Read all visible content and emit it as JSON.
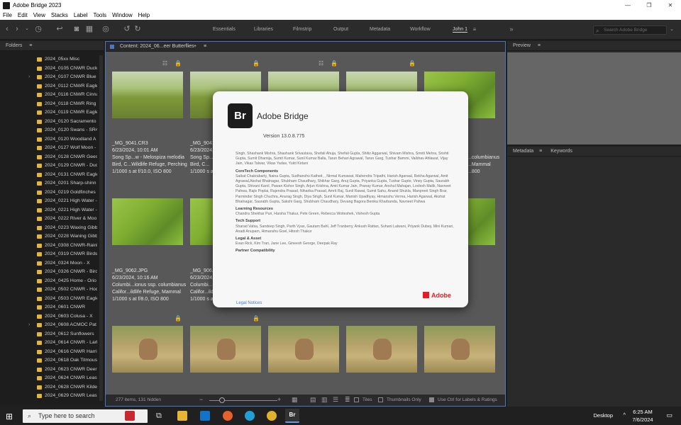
{
  "window": {
    "title": "Adobe Bridge 2023",
    "controls": [
      "—",
      "❐",
      "✕"
    ]
  },
  "menu": [
    "File",
    "Edit",
    "View",
    "Stacks",
    "Label",
    "Tools",
    "Window",
    "Help"
  ],
  "workspaces": [
    "Essentials",
    "Libraries",
    "Filmstrip",
    "Output",
    "Metadata",
    "Workflow",
    "John 1"
  ],
  "search_placeholder": "Search Adobe Bridge",
  "folders_panel": {
    "title": "Folders",
    "items": [
      {
        "name": "2024_05xx Misc",
        "expand": ""
      },
      {
        "name": "2024_0105 CNWR Ducks",
        "expand": ""
      },
      {
        "name": "2024_0107 CNWR Blue W",
        "expand": "›"
      },
      {
        "name": "2024_0112 CNWR Eagle",
        "expand": ""
      },
      {
        "name": "2024_0116 CNWR Cinna",
        "expand": ""
      },
      {
        "name": "2024_0118 CNWR Ring N",
        "expand": ""
      },
      {
        "name": "2024_0119 CNWR Eagle",
        "expand": ""
      },
      {
        "name": "2024_0120 Sacramento",
        "expand": ""
      },
      {
        "name": "2024_0120 Swans - SR45",
        "expand": ""
      },
      {
        "name": "2024_0120 Woodland A",
        "expand": ""
      },
      {
        "name": "2024_0127 Wolf Moon -",
        "expand": ""
      },
      {
        "name": "2024_0128 CNWR Geese",
        "expand": ""
      },
      {
        "name": "2024_0129 CNWR - Duc",
        "expand": ""
      },
      {
        "name": "2024_0131 CNWR Eagle",
        "expand": ""
      },
      {
        "name": "2024_0201 Sharp-shinn",
        "expand": ""
      },
      {
        "name": "2024_0219 Goldfinches",
        "expand": ""
      },
      {
        "name": "2024_0221 High Water -",
        "expand": ""
      },
      {
        "name": "2024_0221 High Water -",
        "expand": ""
      },
      {
        "name": "2024_0222 River & Moo",
        "expand": ""
      },
      {
        "name": "2024_0223 Waxing Gibb",
        "expand": ""
      },
      {
        "name": "2024_0228 Waning Gibb",
        "expand": ""
      },
      {
        "name": "2024_0308 CNWR-Rainb",
        "expand": ""
      },
      {
        "name": "2024_0319 CNWR Birds",
        "expand": ""
      },
      {
        "name": "2024_0324 Moon - X",
        "expand": ""
      },
      {
        "name": "2024_0326 CNWR - Bird",
        "expand": ""
      },
      {
        "name": "2024_0425 Home - Orio",
        "expand": ""
      },
      {
        "name": "2024_0502 CNWR - Hoc",
        "expand": ""
      },
      {
        "name": "2024_0503 CNWR Eagle",
        "expand": ""
      },
      {
        "name": "2024_0601 CNWR",
        "expand": ""
      },
      {
        "name": "2024_0603 Colusa - X",
        "expand": ""
      },
      {
        "name": "2024_0608 ACMOC Pat",
        "expand": "›"
      },
      {
        "name": "2024_0612 Sunflowers",
        "expand": ""
      },
      {
        "name": "2024_0614 CNWR - Lark",
        "expand": ""
      },
      {
        "name": "2024_0616 CNWR Harri",
        "expand": ""
      },
      {
        "name": "2024_0618 Oak Titmous",
        "expand": ""
      },
      {
        "name": "2024_0623 CNWR Deer",
        "expand": ""
      },
      {
        "name": "2024_0624 CNWR Least",
        "expand": ""
      },
      {
        "name": "2024_0628 CNWR Kildee",
        "expand": ""
      },
      {
        "name": "2024_0629 CNWR Least",
        "expand": ""
      }
    ]
  },
  "content_panel": {
    "title": "Content: 2024_06...eer Butterflies",
    "add_icon": "+",
    "items": [
      {
        "filename": "_MG_9041.CR3",
        "date": "6/23/2024, 10:01 AM",
        "desc1": "Song Sp...w - Melospiza melodia",
        "desc2": "Bird, C...Wildlife Refuge, Perching",
        "exposure": "1/1000 s at f/10.0, ISO 800"
      },
      {
        "filename": "_MG_9041...",
        "date": "6/23/2024,...",
        "desc1": "Song Sp...",
        "desc2": "Bird, C...",
        "exposure": "1/1000 s a..."
      },
      {
        "filename": "_MG_9062.JPG",
        "date": "6/23/2024, 10:16 AM",
        "desc1": "Columbi...ionus ssp. columbianus",
        "desc2": "Califor...ildlife Refuge, Mammal",
        "exposure": "1/1000 s at f/8.0, ISO 800"
      },
      {
        "filename": "_MG_906...",
        "date": "6/23/2024,...",
        "desc1": "Columbi...io",
        "desc2": "Califor...ild",
        "exposure": "1/1000 s a..."
      },
      {
        "filename": "",
        "date": "",
        "desc1": "...columbianus",
        "desc2": "...Mammal",
        "exposure": "...800"
      }
    ],
    "footer": {
      "count": "277 items, 131 hidden",
      "tiles_label": "Tiles",
      "thumbs_only": "Thumbnails Only",
      "ctrl_label": "Use Ctrl for Labels & Ratings"
    }
  },
  "preview_panel": {
    "title": "Preview"
  },
  "metadata_panel": {
    "tab1": "Metadata",
    "tab2": "Keywords"
  },
  "about_dialog": {
    "logo": "Br",
    "name": "Adobe Bridge",
    "version": "Version 13.0.8.775",
    "credits_intro": "Singh, Shashank Mishra, Shashank Srivastava, Shefali Ahuja, Shefali Gupta, Shitiz Aggarwal, Shivam Mishra, Smriti Mehra, Srishti Gupta, Sumit Dhamija, Sumit Kumar, Sunil Kumar Balla, Tarun Behari Agrawal, Tarun Garg, Tushar Bammi, Vaibhav Ahlawat, Vijay Jain, Vikas Talwar, Vikas Yadav, Yukti Kirtani",
    "sections": [
      {
        "heading": "CoreTech Components",
        "text": "Saikat Chakrabarty, Naina Gupta, Sudhanshu Katheit, , Nirmal Kumawat, Mahendra Tripathi, Harish Agarwal, Rekha Agarwal, Amit Agrawal,Akshat Bhatnagar, Shubham Chaudhary, Shikhar Garg, Anuj Gupta, Priyanka Gupta, Tushar Gupte, Viney Gupta, Saurabh Gupta, Shivani Karol, Pawan Kishor Singh, Arjun Krishna, Amit Kumar Jain, Pranay Kumar, Anshul Mahajan, Lovlesh Malik, Navneet Pahwa, Rajiv Poplai, Rajendra Prasad, Niharika Prasad, Amrit Raj, Sunil Rawat, Sumit Sahu, Anand Shukla, Manpreet Singh Brar, Parminder Singh Chuchra, Anurag Singh, Diya Singh, Sunil Kumar, Manish Upadhyay, Himanshu Verma, Harish Agarwal, Akshat Bhatnagar, Saurabh Gupta, Sakshi Garg, Shubham Chaudhary, Devang Bagora Benika Kharbanda, Navneet Pahwa"
      },
      {
        "heading": "Learning Resources",
        "text": "Chandra Shekhar Puri, Harsha Thakur, Pete Green, Rebecca Woiteshek, Vishesh Gupta"
      },
      {
        "heading": "Tech Support",
        "text": "Sharad Vatsa, Sandeep Singh, Parth Vyas, Gautam Bahl, Jeff Tranberry, Ankush Rattan, Suhani Lalwani, Priyank Dubey, Mini Kumari, Anadi Anupam, Himanshu Goel, Hitesh Thakur"
      },
      {
        "heading": "Legal & Asset",
        "text": "Evan Rick, Kim Tran, Jane Lee, Gineesh George, Deepak Ray"
      },
      {
        "heading": "Partner Compatibility",
        "text": ""
      }
    ],
    "adobe_label": "Adobe",
    "legal_link": "Legal Notices"
  },
  "taskbar": {
    "search_placeholder": "Type here to search",
    "desktop_label": "Desktop",
    "time": "6:25 AM",
    "date": "7/6/2024"
  }
}
